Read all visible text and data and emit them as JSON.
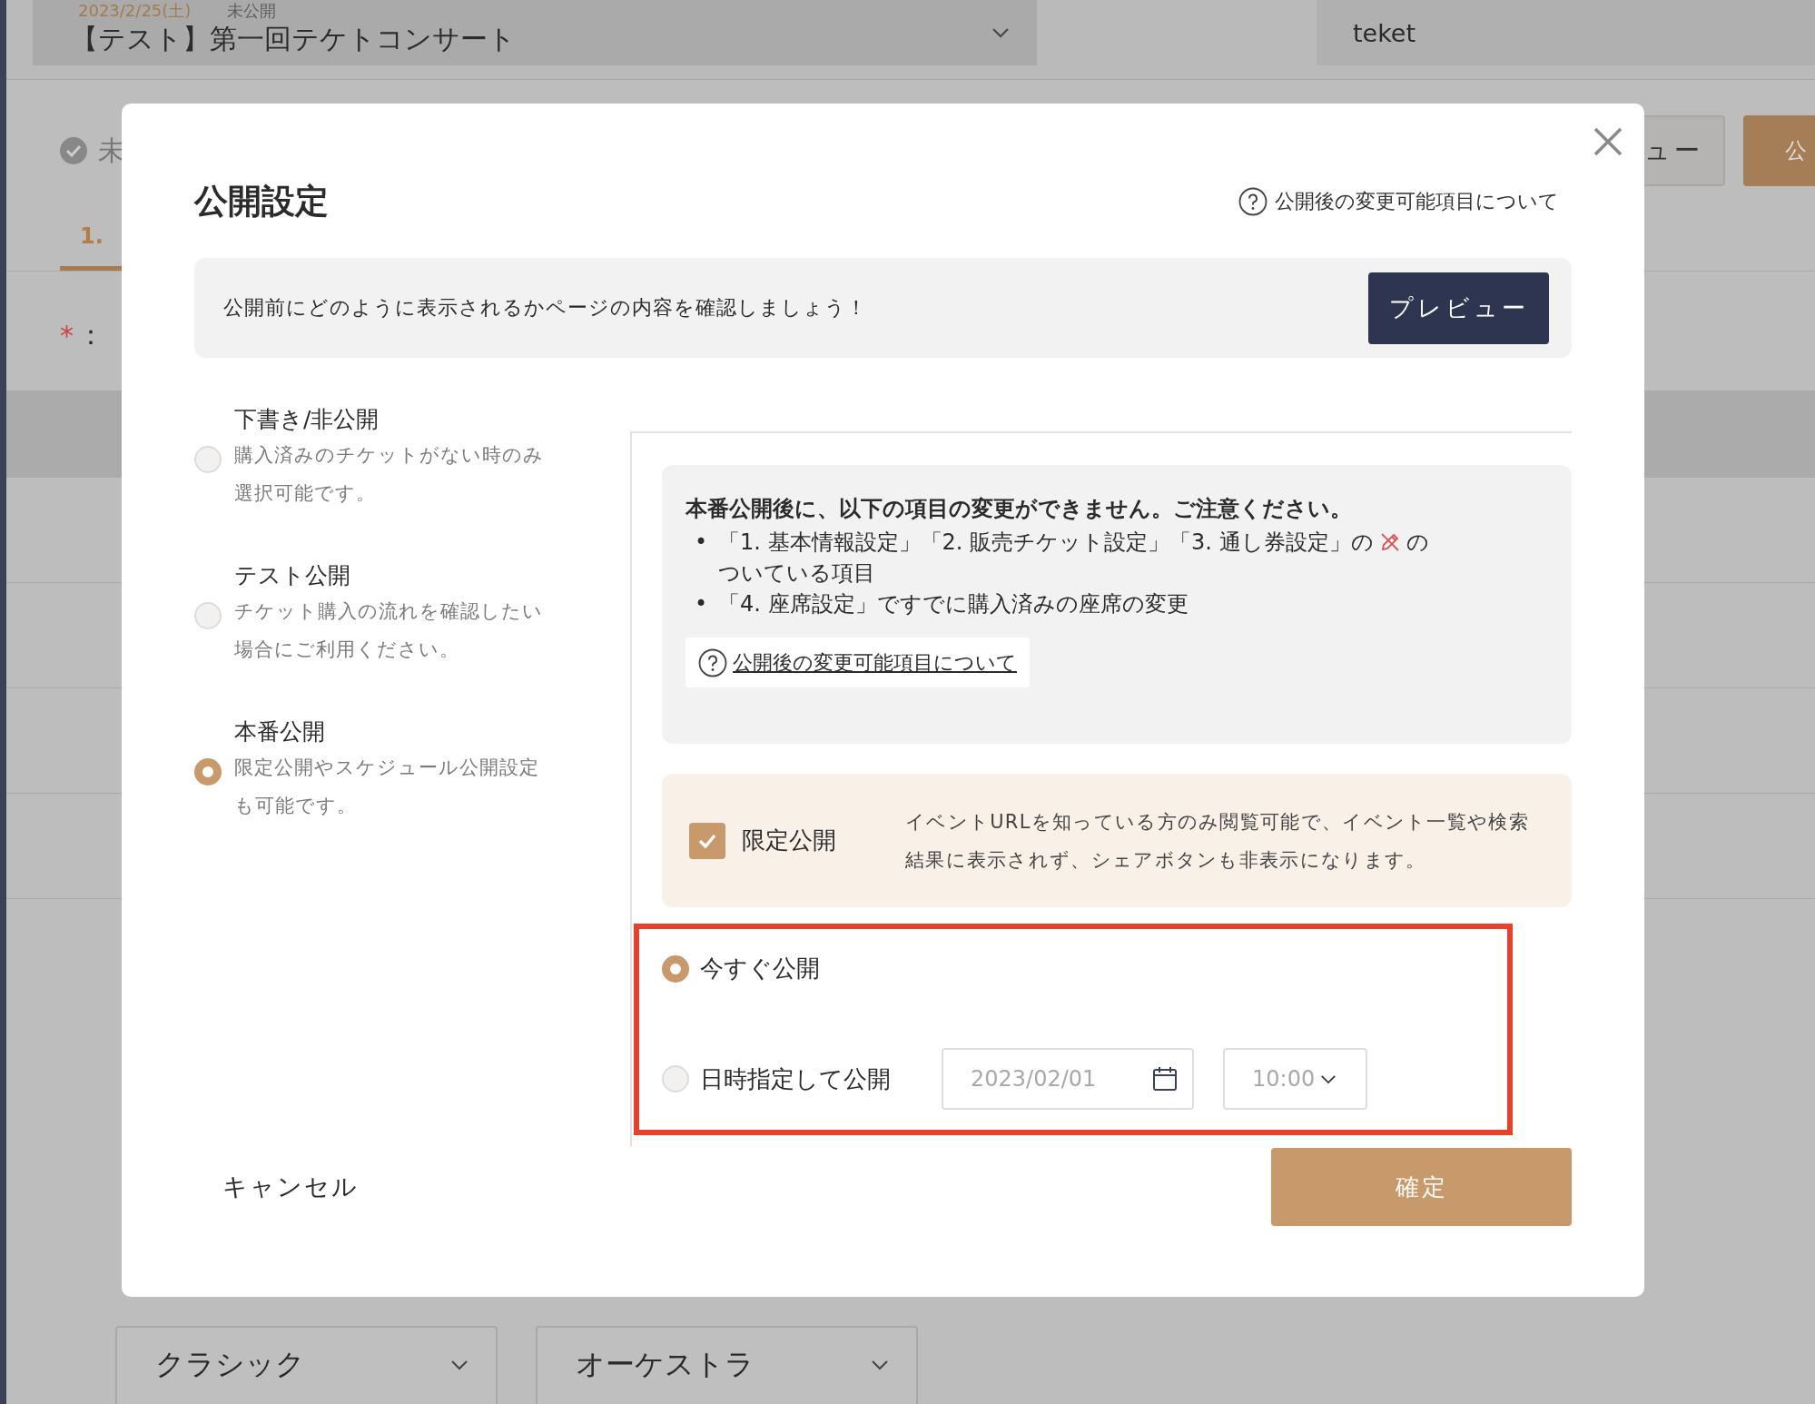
{
  "background": {
    "event_date": "2023/2/25(土)",
    "event_status": "未公開",
    "event_title": "【テスト】第一回テケトコンサート",
    "account": "teket",
    "status_label": "未",
    "step_tab": "1.",
    "required_mark": "*",
    "required_legend": "：",
    "preview_button": "ュー",
    "publish_button": "公",
    "category_selects": [
      {
        "value": "クラシック"
      },
      {
        "value": "オーケストラ"
      }
    ]
  },
  "dialog": {
    "title": "公開設定",
    "help_link": "公開後の変更可能項目について",
    "preview_notice": "公開前にどのように表示されるかページの内容を確認しましょう！",
    "preview_button": "プレビュー",
    "modes": [
      {
        "label": "下書き/非公開",
        "description": "購入済みのチケットがない時のみ選択可能です。",
        "selected": false
      },
      {
        "label": "テスト公開",
        "description": "チケット購入の流れを確認したい場合にご利用ください。",
        "selected": false
      },
      {
        "label": "本番公開",
        "description": "限定公開やスケジュール公開設定も可能です。",
        "selected": true
      }
    ],
    "warning": {
      "heading": "本番公開後に、以下の項目の変更ができません。ご注意ください。",
      "items": [
        {
          "marker": "•",
          "text": "「1. 基本情報設定」「2. 販売チケット設定」「3. 通し券設定」の",
          "text_after_icon": "の",
          "continuation": "ついている項目"
        },
        {
          "marker": "•",
          "text": "「4. 座席設定」ですでに購入済みの座席の変更"
        }
      ],
      "link": "公開後の変更可能項目について"
    },
    "limited": {
      "label": "限定公開",
      "checked": true,
      "description": "イベントURLを知っている方のみ閲覧可能で、イベント一覧や検索結果に表示されず、シェアボタンも非表示になります。"
    },
    "schedule": [
      {
        "kind": "now",
        "label": "今すぐ公開",
        "selected": true
      },
      {
        "kind": "scheduled",
        "label": "日時指定して公開",
        "selected": false,
        "date": "2023/02/01",
        "time": "10:00"
      }
    ],
    "cancel": "キャンセル",
    "confirm": "確定"
  }
}
